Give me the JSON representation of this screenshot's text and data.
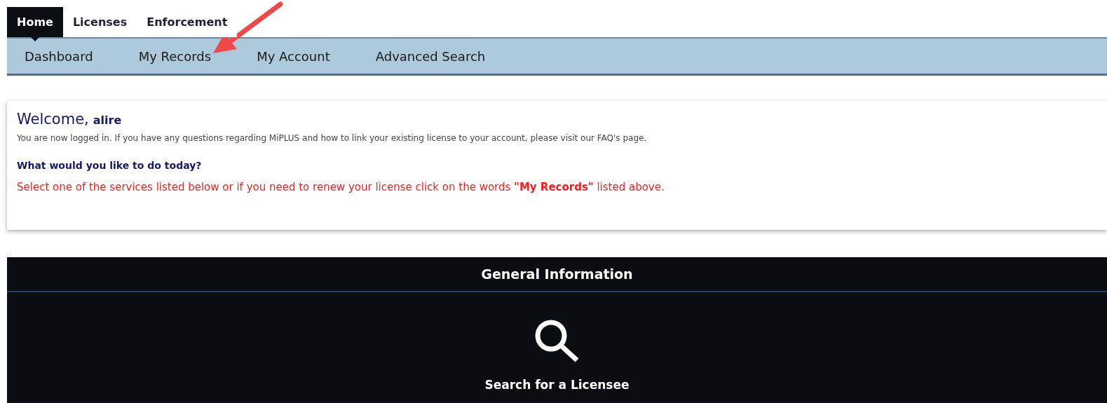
{
  "top_tabs": [
    {
      "label": "Home",
      "selected": true
    },
    {
      "label": "Licenses",
      "selected": false
    },
    {
      "label": "Enforcement",
      "selected": false
    }
  ],
  "sub_nav": [
    {
      "label": "Dashboard"
    },
    {
      "label": "My Records"
    },
    {
      "label": "My Account"
    },
    {
      "label": "Advanced Search"
    }
  ],
  "welcome": {
    "greeting": "Welcome,",
    "user": "alire",
    "message": "You are now logged in. If you have any questions regarding MiPLUS and how to link your existing license to your account, please visit our FAQ's page.",
    "question": "What would you like to do today?",
    "instruction": "Select one of the services listed below or if you need to renew your license click on the words **\"My Records\"** listed above."
  },
  "general_information": {
    "title": "General Information",
    "services": [
      {
        "label": "Search for a Licensee"
      }
    ]
  }
}
